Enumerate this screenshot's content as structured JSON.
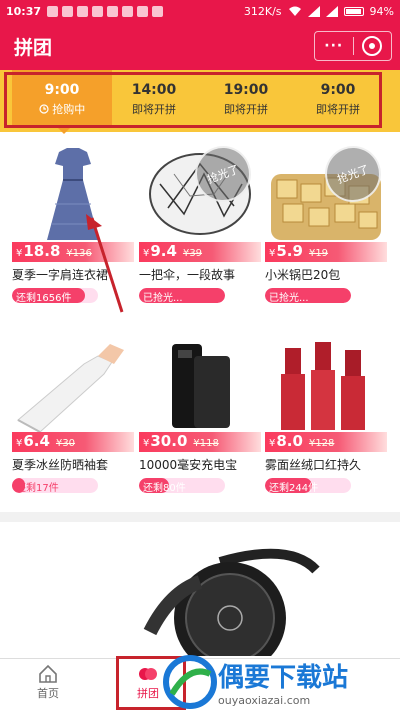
{
  "status_bar": {
    "time": "10:37",
    "net_speed": "312K/s",
    "battery": "94%"
  },
  "header": {
    "title": "拼团",
    "more_label": "···"
  },
  "time_slots": [
    {
      "time": "9:00",
      "status": "抢购中",
      "active": true
    },
    {
      "time": "14:00",
      "status": "即将开拼",
      "active": false
    },
    {
      "time": "19:00",
      "status": "即将开拼",
      "active": false
    },
    {
      "time": "9:00",
      "status": "即将开拼",
      "active": false
    }
  ],
  "products": [
    {
      "name": "夏季一字肩连衣裙",
      "currency": "¥",
      "price": "18.8",
      "old_price": "¥136",
      "remain": "还剩1656件",
      "remain_fraction": 0.85,
      "sold_out": false
    },
    {
      "name": "一把伞，一段故事",
      "currency": "¥",
      "price": "9.4",
      "old_price": "¥39",
      "remain": "已抢光...",
      "remain_fraction": 1.0,
      "sold_out": true,
      "sold_out_label": "抢光了"
    },
    {
      "name": "小米锅巴20包",
      "currency": "¥",
      "price": "5.9",
      "old_price": "¥19",
      "remain": "已抢光...",
      "remain_fraction": 1.0,
      "sold_out": true,
      "sold_out_label": "抢光了"
    },
    {
      "name": "夏季冰丝防晒袖套",
      "currency": "¥",
      "price": "6.4",
      "old_price": "¥30",
      "remain": "还剩17件",
      "remain_fraction": 0.15,
      "sold_out": false
    },
    {
      "name": "10000毫安充电宝",
      "currency": "¥",
      "price": "30.0",
      "old_price": "¥118",
      "remain": "还剩80件",
      "remain_fraction": 0.35,
      "sold_out": false
    },
    {
      "name": "雾面丝绒口红持久",
      "currency": "¥",
      "price": "8.0",
      "old_price": "¥128",
      "remain": "还剩244件",
      "remain_fraction": 0.55,
      "sold_out": false
    }
  ],
  "tabs": [
    {
      "label": "首页",
      "icon": "home-icon",
      "active": false
    },
    {
      "label": "拼团",
      "icon": "group-buy-icon",
      "active": true
    }
  ],
  "watermark": {
    "text": "偶要下载站",
    "url": "ouyaoxiazai.com"
  },
  "colors": {
    "brand": "#e8174a",
    "timebar": "#f9c63a",
    "active_slot": "#f5a02a",
    "annotation": "#c7232c"
  }
}
